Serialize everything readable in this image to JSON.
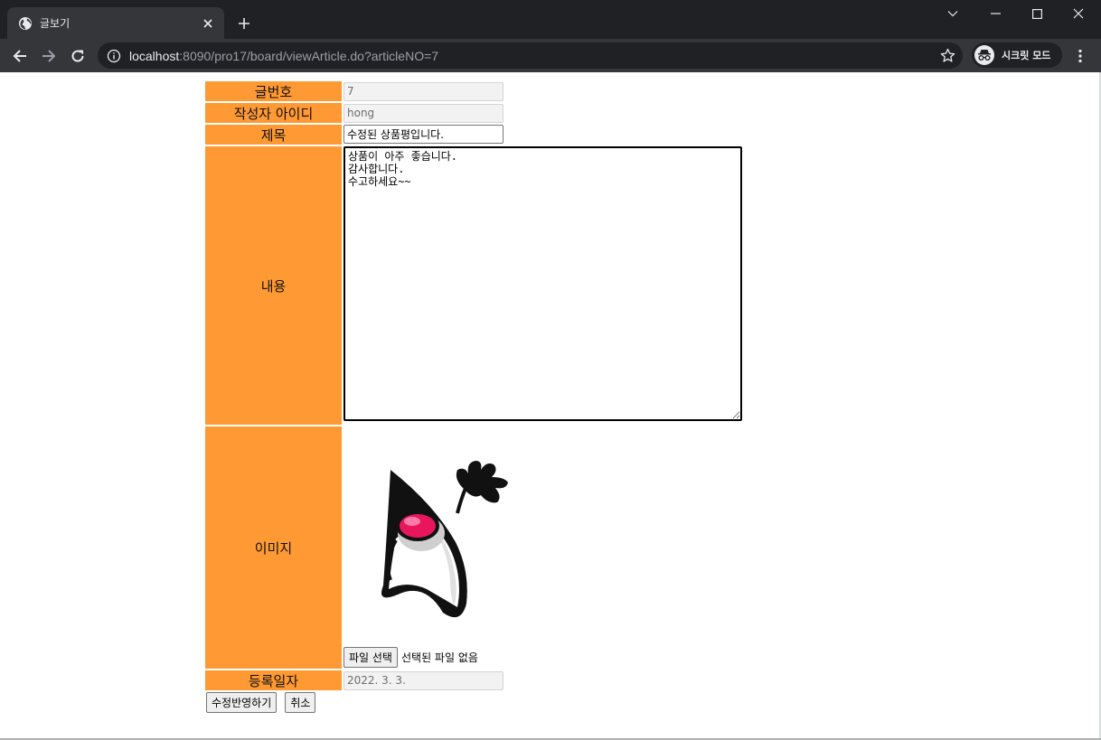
{
  "browser": {
    "tab_title": "글보기",
    "url_host": "localhost",
    "url_rest": ":8090/pro17/board/viewArticle.do?articleNO=7",
    "incognito_label": "시크릿 모드"
  },
  "form": {
    "article_no": {
      "label": "글번호",
      "value": "7"
    },
    "writer": {
      "label": "작성자 아이디",
      "value": "hong"
    },
    "title": {
      "label": "제목",
      "value": "수정된 상품평입니다."
    },
    "content": {
      "label": "내용",
      "value": "상품이 아주 좋습니다.\n감사합니다.\n수고하세요~~"
    },
    "image": {
      "label": "이미지",
      "file_button": "파일 선택",
      "file_status": "선택된 파일 없음"
    },
    "reg_date": {
      "label": "등록일자",
      "value": "2022. 3. 3."
    }
  },
  "actions": {
    "apply_label": "수정반영하기",
    "cancel_label": "취소"
  },
  "colors": {
    "label_bg": "#ff9933",
    "chrome_dark": "#202124",
    "chrome_tab": "#35363a"
  },
  "icons": [
    "globe-icon",
    "close-icon",
    "plus-icon",
    "chevron-down-icon",
    "minimize-icon",
    "maximize-icon",
    "back-arrow-icon",
    "forward-arrow-icon",
    "reload-icon",
    "info-icon",
    "star-icon",
    "incognito-icon",
    "kebab-menu-icon"
  ]
}
